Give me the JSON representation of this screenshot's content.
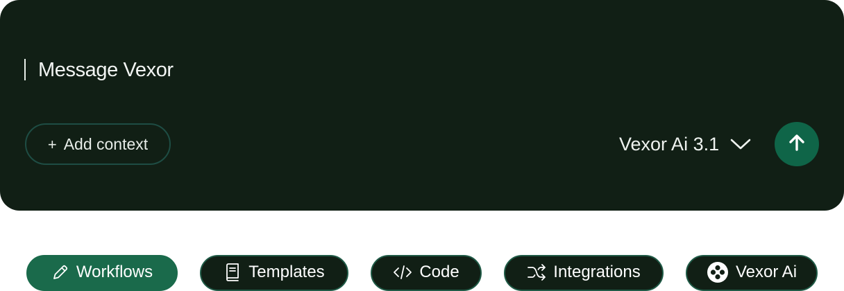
{
  "composer": {
    "placeholder": "Message Vexor",
    "add_context_label": "Add context",
    "model_name": "Vexor Ai 3.1",
    "send_icon": "arrow-up-icon"
  },
  "chips": [
    {
      "label": "Workflows",
      "icon": "pencil-icon",
      "active": true
    },
    {
      "label": "Templates",
      "icon": "book-icon",
      "active": false
    },
    {
      "label": "Code",
      "icon": "code-icon",
      "active": false
    },
    {
      "label": "Integrations",
      "icon": "shuffle-icon",
      "active": false
    },
    {
      "label": "Vexor Ai",
      "icon": "vexor-logo-icon",
      "active": false
    }
  ],
  "colors": {
    "background": "#111f15",
    "accent": "#1a6a4b",
    "send_button": "#0f6548",
    "outline": "#1f5a46",
    "page": "#ffffff"
  }
}
